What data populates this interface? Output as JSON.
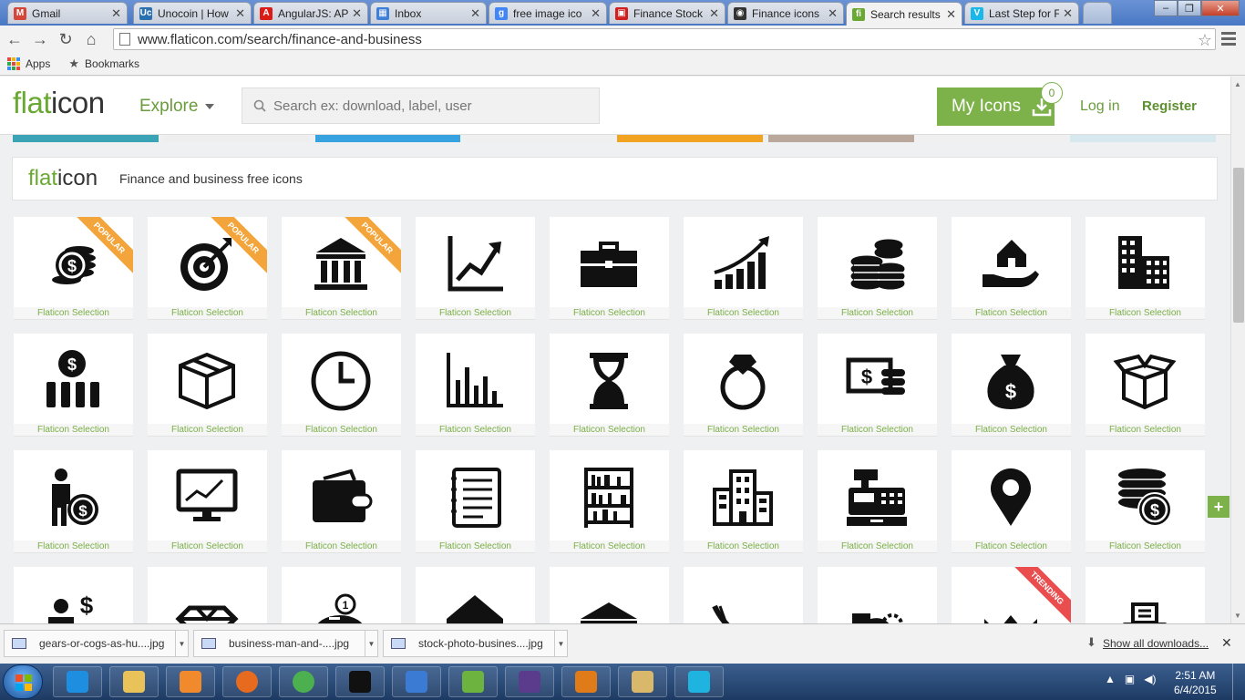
{
  "browser": {
    "tabs": [
      {
        "label": "Gmail",
        "icon": "gmail-icon",
        "color": "#d44638",
        "glyph": "M"
      },
      {
        "label": "Unocoin | How",
        "icon": "unocoin-icon",
        "color": "#2a6fb0",
        "glyph": "Uc"
      },
      {
        "label": "AngularJS: API",
        "icon": "angular-icon",
        "color": "#dd1b16",
        "glyph": "A"
      },
      {
        "label": "Inbox",
        "icon": "inbox-icon",
        "color": "#3f7fd8",
        "glyph": "▦"
      },
      {
        "label": "free image ico",
        "icon": "google-icon",
        "color": "#4285f4",
        "glyph": "g"
      },
      {
        "label": "Finance Stock",
        "icon": "adobe-stock-icon",
        "color": "#d01f1f",
        "glyph": "▣"
      },
      {
        "label": "Finance icons",
        "icon": "eye-icon",
        "color": "#333333",
        "glyph": "◉"
      },
      {
        "label": "Search results",
        "icon": "flaticon-tab-icon",
        "color": "#69a933",
        "glyph": "fi"
      },
      {
        "label": "Last Step for F",
        "icon": "vimeo-icon",
        "color": "#1ab7ea",
        "glyph": "V"
      }
    ],
    "url": "www.flaticon.com/search/finance-and-business",
    "bookmarks": {
      "apps": "Apps",
      "bookmarks": "Bookmarks"
    }
  },
  "site": {
    "logo_a": "flat",
    "logo_b": "icon",
    "explore": "Explore",
    "search_placeholder": "Search ex: download, label, user",
    "my_icons": "My Icons",
    "badge_count": "0",
    "login": "Log in",
    "register": "Register",
    "collection_title": "Finance and business free icons",
    "accent": "#7db24a"
  },
  "icons": [
    {
      "name": "coins-dollar-icon",
      "caption": "Flaticon Selection",
      "ribbon": "POPULAR"
    },
    {
      "name": "target-arrow-icon",
      "caption": "Flaticon Selection",
      "ribbon": "POPULAR"
    },
    {
      "name": "bank-icon",
      "caption": "Flaticon Selection",
      "ribbon": "POPULAR"
    },
    {
      "name": "line-chart-icon",
      "caption": "Flaticon Selection",
      "ribbon": ""
    },
    {
      "name": "briefcase-icon",
      "caption": "Flaticon Selection",
      "ribbon": ""
    },
    {
      "name": "growth-bars-icon",
      "caption": "Flaticon Selection",
      "ribbon": ""
    },
    {
      "name": "coin-stacks-icon",
      "caption": "Flaticon Selection",
      "ribbon": ""
    },
    {
      "name": "house-in-hand-icon",
      "caption": "Flaticon Selection",
      "ribbon": ""
    },
    {
      "name": "buildings-icon",
      "caption": "Flaticon Selection",
      "ribbon": ""
    },
    {
      "name": "dollar-bars-icon",
      "caption": "Flaticon Selection",
      "ribbon": ""
    },
    {
      "name": "box-icon",
      "caption": "Flaticon Selection",
      "ribbon": ""
    },
    {
      "name": "clock-icon",
      "caption": "Flaticon Selection",
      "ribbon": ""
    },
    {
      "name": "bar-chart-icon",
      "caption": "Flaticon Selection",
      "ribbon": ""
    },
    {
      "name": "hourglass-icon",
      "caption": "Flaticon Selection",
      "ribbon": ""
    },
    {
      "name": "diamond-ring-icon",
      "caption": "Flaticon Selection",
      "ribbon": ""
    },
    {
      "name": "cash-coins-icon",
      "caption": "Flaticon Selection",
      "ribbon": ""
    },
    {
      "name": "money-bag-icon",
      "caption": "Flaticon Selection",
      "ribbon": ""
    },
    {
      "name": "open-box-icon",
      "caption": "Flaticon Selection",
      "ribbon": ""
    },
    {
      "name": "businessman-dollar-icon",
      "caption": "Flaticon Selection",
      "ribbon": ""
    },
    {
      "name": "monitor-chart-icon",
      "caption": "Flaticon Selection",
      "ribbon": ""
    },
    {
      "name": "wallet-icon",
      "caption": "Flaticon Selection",
      "ribbon": ""
    },
    {
      "name": "notepad-icon",
      "caption": "Flaticon Selection",
      "ribbon": ""
    },
    {
      "name": "bookshelf-icon",
      "caption": "Flaticon Selection",
      "ribbon": ""
    },
    {
      "name": "city-buildings-icon",
      "caption": "Flaticon Selection",
      "ribbon": ""
    },
    {
      "name": "cash-register-icon",
      "caption": "Flaticon Selection",
      "ribbon": ""
    },
    {
      "name": "location-pin-icon",
      "caption": "Flaticon Selection",
      "ribbon": ""
    },
    {
      "name": "coins-dollar-stack-icon",
      "caption": "Flaticon Selection",
      "ribbon": ""
    },
    {
      "name": "businessman-desk-icon",
      "caption": "",
      "ribbon": ""
    },
    {
      "name": "diamond-icon",
      "caption": "",
      "ribbon": ""
    },
    {
      "name": "piggy-bank-icon",
      "caption": "",
      "ribbon": ""
    },
    {
      "name": "house-dollar-icon",
      "caption": "",
      "ribbon": ""
    },
    {
      "name": "bank-roof-icon",
      "caption": "",
      "ribbon": ""
    },
    {
      "name": "falling-chart-icon",
      "caption": "",
      "ribbon": ""
    },
    {
      "name": "hand-coin-icon",
      "caption": "",
      "ribbon": ""
    },
    {
      "name": "crown-icon",
      "caption": "",
      "ribbon": "TRENDING"
    },
    {
      "name": "cash-machine-icon",
      "caption": "",
      "ribbon": ""
    }
  ],
  "downloads": {
    "files": [
      "gears-or-cogs-as-hu....jpg",
      "business-man-and-....jpg",
      "stock-photo-busines....jpg"
    ],
    "show_all": "Show all downloads..."
  },
  "taskbar": {
    "time": "2:51 AM",
    "date": "6/4/2015",
    "apps": [
      {
        "name": "internet-explorer-icon",
        "color": "#1e8fe0"
      },
      {
        "name": "file-explorer-icon",
        "color": "#e9c35a"
      },
      {
        "name": "media-player-icon",
        "color": "#f08a2c"
      },
      {
        "name": "firefox-icon",
        "color": "#e66b1f"
      },
      {
        "name": "chrome-icon",
        "color": "#4caf50"
      },
      {
        "name": "command-prompt-icon",
        "color": "#111111"
      },
      {
        "name": "text-editor-icon",
        "color": "#3b7bd3"
      },
      {
        "name": "spring-tool-icon",
        "color": "#6db33f"
      },
      {
        "name": "java-ee-ide-icon",
        "color": "#5b3b8c"
      },
      {
        "name": "outlook-icon",
        "color": "#e07b1a"
      },
      {
        "name": "paint-icon",
        "color": "#d9b86b"
      },
      {
        "name": "webstorm-icon",
        "color": "#1fb3e0"
      }
    ]
  }
}
